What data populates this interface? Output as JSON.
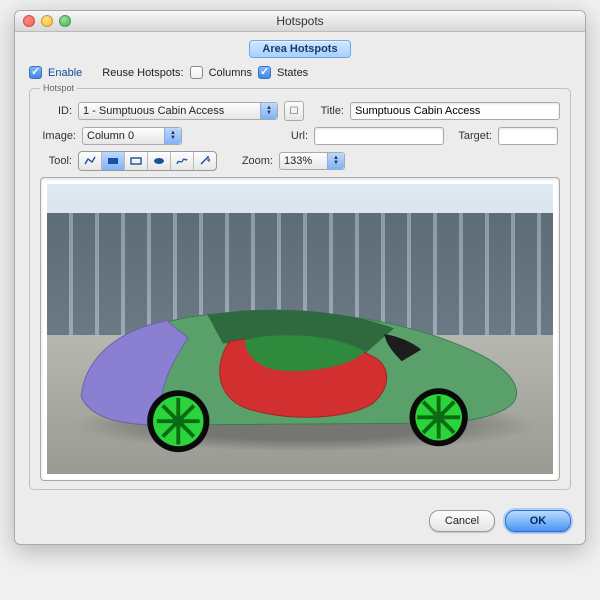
{
  "window": {
    "title": "Hotspots"
  },
  "tabs": {
    "area_hotspots": "Area Hotspots"
  },
  "options": {
    "enable_label": "Enable",
    "enable_checked": true,
    "reuse_label": "Reuse Hotspots:",
    "columns_label": "Columns",
    "columns_checked": false,
    "states_label": "States",
    "states_checked": true
  },
  "fieldset": {
    "legend": "Hotspot"
  },
  "fields": {
    "id_label": "ID:",
    "id_value": "1 - Sumptuous Cabin Access",
    "title_label": "Title:",
    "title_value": "Sumptuous Cabin Access",
    "image_label": "Image:",
    "image_value": "Column 0",
    "url_label": "Url:",
    "url_value": "",
    "target_label": "Target:",
    "target_value": "",
    "tool_label": "Tool:",
    "zoom_label": "Zoom:",
    "zoom_value": "133%"
  },
  "tools": {
    "t1": "polyline",
    "t2": "rect-fill",
    "t3": "rect-outline",
    "t4": "ellipse",
    "t5": "freehand",
    "t6": "wand"
  },
  "buttons": {
    "cancel": "Cancel",
    "ok": "OK"
  }
}
